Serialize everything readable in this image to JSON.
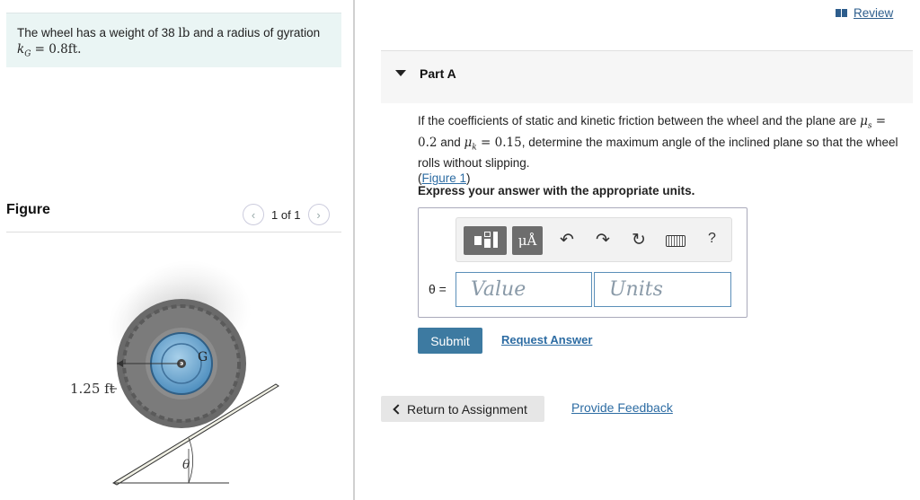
{
  "problem": {
    "text_prefix": "The wheel has a weight of 38 ",
    "weight_unit": "lb",
    "text_mid": " and a radius of gyration",
    "kg_symbol": "k",
    "kg_sub": "G",
    "kg_value": " = 0.8ft."
  },
  "figure": {
    "label": "Figure",
    "pager_text": "1 of 1",
    "radius_label": "1.25 ft",
    "center_label": "G",
    "angle_label": "θ"
  },
  "review": {
    "label": "Review"
  },
  "part": {
    "title": "Part A"
  },
  "question": {
    "text1": "If the coefficients of static and kinetic friction between the wheel and the plane are ",
    "mu": "μ",
    "s_sub": "s",
    "eq1": " = 0.2",
    "and": " and ",
    "k_sub": "k",
    "eq2": " = 0.15",
    "text2": ", determine the maximum angle of the inclined plane so that the wheel rolls without slipping.",
    "link_open": "(",
    "figure_link": "Figure 1",
    "link_close": ")"
  },
  "instruction": "Express your answer with the appropriate units.",
  "answer": {
    "variable_label": "θ =",
    "value_placeholder": "Value",
    "units_placeholder": "Units",
    "toolbar_units_label": "μÅ",
    "help_label": "?"
  },
  "actions": {
    "submit_label": "Submit",
    "request_label": "Request Answer",
    "return_label": "Return to Assignment",
    "feedback_label": "Provide Feedback"
  },
  "colors": {
    "problem_bg": "#eaf5f4",
    "link": "#2d6ca3",
    "submit_bg": "#3d7aa1",
    "input_border": "#5b8fb9"
  }
}
